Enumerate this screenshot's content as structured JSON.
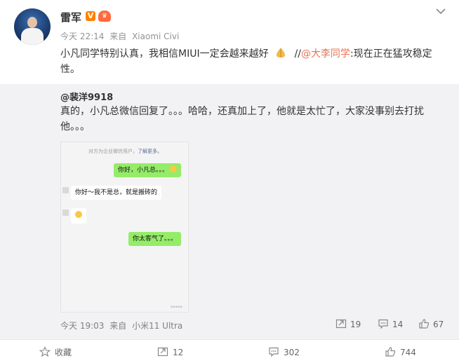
{
  "post": {
    "author": "雷军",
    "time": "今天 22:14",
    "source_prefix": "来自",
    "source": "Xiaomi Civi",
    "text_before": "小凡同学特别认真，我相信MIUI一定会越来越好",
    "repost_sep": "//",
    "mention": "@大李同学",
    "text_after": ":现在正在猛攻稳定性。"
  },
  "retweet": {
    "author": "@裴洋9918",
    "text": "真的，小凡总微信回复了。。。哈哈，还真加上了，他就是太忙了，大家没事别去打扰他。。。",
    "screenshot": {
      "notice": "对方为企业微信用户，",
      "notice_link": "了解更多。",
      "messages": [
        {
          "side": "me",
          "text": "你好，小凡总。。。"
        },
        {
          "side": "them",
          "text": "你好～我不是总，就是搬砖的"
        },
        {
          "side": "them",
          "text": ""
        },
        {
          "side": "me",
          "text": "你太客气了。。。"
        }
      ]
    },
    "time": "今天 19:03",
    "source_prefix": "来自",
    "source": "小米11 Ultra",
    "reposts": "19",
    "comments": "14",
    "likes": "67"
  },
  "footer": {
    "favorite_label": "收藏",
    "repost_count": "12",
    "comment_count": "302",
    "like_count": "744"
  },
  "colors": {
    "link": "#eb7350",
    "verified": "#ff8200",
    "wechat_green": "#95ec69",
    "retweet_bg": "#f2f2f5"
  }
}
